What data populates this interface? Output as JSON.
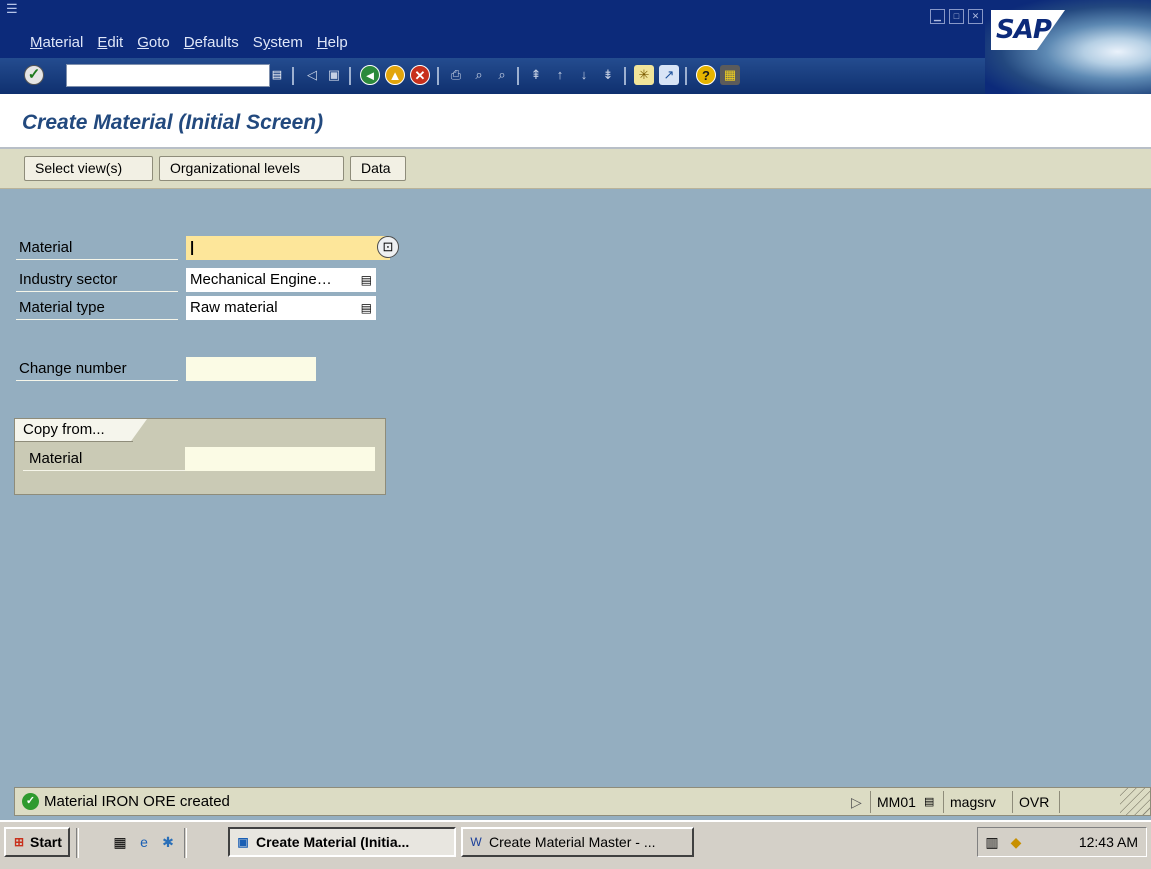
{
  "window": {
    "menus": [
      {
        "label": "Material",
        "mnemonic": "M",
        "rest": "aterial"
      },
      {
        "label": "Edit",
        "mnemonic": "E",
        "rest": "dit"
      },
      {
        "label": "Goto",
        "mnemonic": "G",
        "rest": "oto"
      },
      {
        "label": "Defaults",
        "mnemonic": "D",
        "rest": "efaults"
      },
      {
        "label": "System",
        "mnemonic": "y",
        "pre": "S",
        "rest": "stem"
      },
      {
        "label": "Help",
        "mnemonic": "H",
        "rest": "elp"
      }
    ],
    "logo_text": "SAP"
  },
  "toolbar": {
    "command_field_value": "",
    "icons": [
      "enter-icon",
      "back-arrow-icon",
      "save-icon",
      "back-icon",
      "exit-icon",
      "cancel-icon",
      "print-icon",
      "find-icon",
      "find-next-icon",
      "first-page-icon",
      "previous-page-icon",
      "next-page-icon",
      "last-page-icon",
      "create-session-icon",
      "create-shortcut-icon",
      "help-icon",
      "customize-layout-icon"
    ]
  },
  "page": {
    "title": "Create Material (Initial Screen)"
  },
  "app_toolbar": {
    "buttons": [
      "Select view(s)",
      "Organizational levels",
      "Data"
    ]
  },
  "form": {
    "material": {
      "label": "Material",
      "value": ""
    },
    "industry_sector": {
      "label": "Industry sector",
      "value": "Mechanical Engine…"
    },
    "material_type": {
      "label": "Material type",
      "value": "Raw material"
    },
    "change_number": {
      "label": "Change number",
      "value": ""
    },
    "copy_from": {
      "tab_label": "Copy from...",
      "material": {
        "label": "Material",
        "value": ""
      }
    }
  },
  "status_bar": {
    "message": "Material IRON ORE created",
    "message_type": "success",
    "transaction": "MM01",
    "server": "magsrv",
    "mode": "OVR"
  },
  "taskbar": {
    "start_label": "Start",
    "tasks": [
      {
        "label": "Create Material (Initia...",
        "active": true
      },
      {
        "label": "Create Material Master - ...",
        "active": false
      }
    ],
    "clock": "12:43 AM"
  },
  "colors": {
    "menu_bar": "#0c2a7a",
    "title_text": "#22497e",
    "work_area": "#94aec0",
    "focused_field": "#fde69a",
    "input_field": "#fbfbe5",
    "app_toolbar": "#dcdcc4",
    "success_icon": "#2f9a2f"
  }
}
